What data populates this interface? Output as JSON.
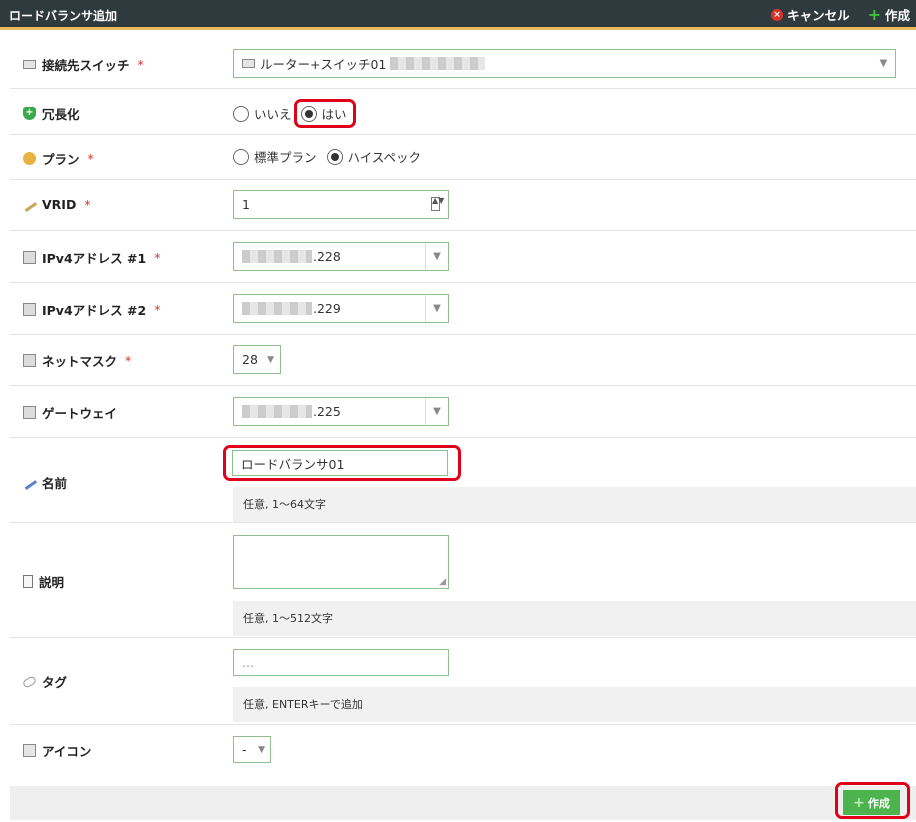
{
  "header": {
    "title": "ロードバランサ追加",
    "cancel": "キャンセル",
    "create": "作成"
  },
  "switch": {
    "label": "接続先スイッチ",
    "value": "ルーター+スイッチ01"
  },
  "redundancy": {
    "label": "冗長化",
    "options": [
      "いいえ",
      "はい"
    ],
    "selected": "はい"
  },
  "plan": {
    "label": "プラン",
    "options": [
      "標準プラン",
      "ハイスペック"
    ],
    "selected": "ハイスペック"
  },
  "vrid": {
    "label": "VRID",
    "value": "1"
  },
  "ipv4_1": {
    "label": "IPv4アドレス #1",
    "value": ".228"
  },
  "ipv4_2": {
    "label": "IPv4アドレス #2",
    "value": ".229"
  },
  "netmask": {
    "label": "ネットマスク",
    "value": "28"
  },
  "gateway": {
    "label": "ゲートウェイ",
    "value": ".225"
  },
  "name": {
    "label": "名前",
    "value": "ロードバランサ01",
    "hint": "任意, 1〜64文字"
  },
  "description": {
    "label": "説明",
    "value": "",
    "hint": "任意, 1〜512文字"
  },
  "tags": {
    "label": "タグ",
    "placeholder": "...",
    "hint": "任意, ENTERキーで追加"
  },
  "icon": {
    "label": "アイコン",
    "value": "-"
  },
  "footer": {
    "create": "作成"
  },
  "required_mark": "*"
}
